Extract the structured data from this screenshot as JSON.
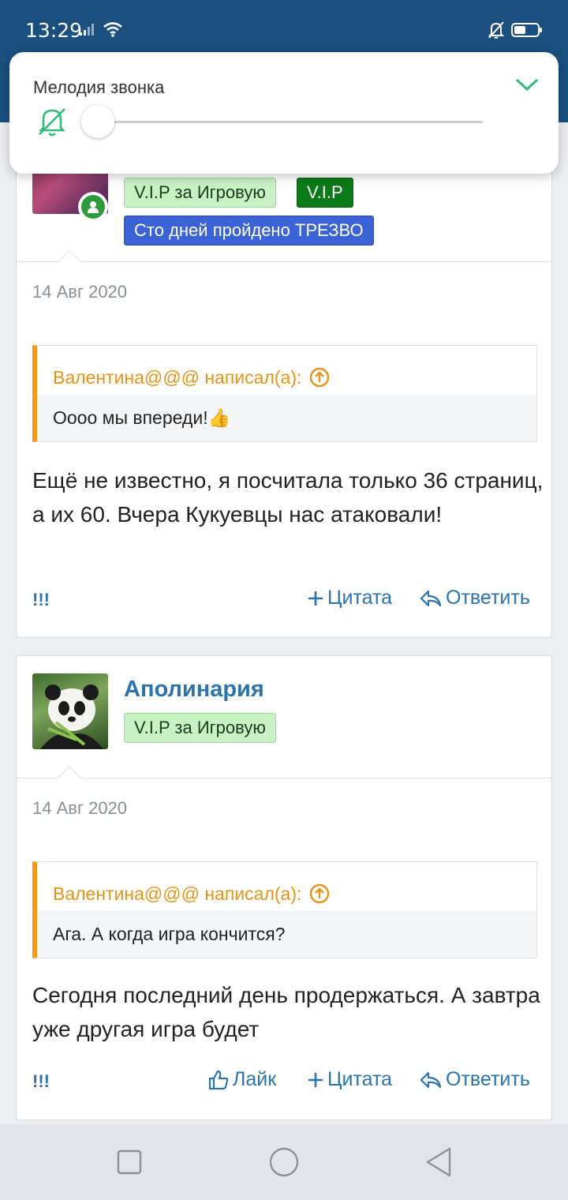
{
  "status_bar": {
    "time": "13:29",
    "icons": [
      "signal-icon",
      "wifi-icon",
      "bell-off-icon",
      "battery-icon"
    ]
  },
  "colors": {
    "header": "#1a4f7f",
    "link": "#2b73ae",
    "quote_accent": "#f29a17",
    "ring_accent": "#2ebd79",
    "badge_vip_game_bg": "#c8f2c4",
    "badge_vip_bg": "#0c7a18",
    "badge_sober_bg": "#3b63d6"
  },
  "ring_panel": {
    "title": "Мелодия звонка",
    "volume_fraction": 0.0,
    "icons": [
      "bell-off-icon",
      "chevron-down-icon"
    ]
  },
  "posts": [
    {
      "badges": [
        "V.I.P за Игровую",
        "V.I.P",
        "Сто дней пройдено ТРЕЗВО"
      ],
      "date": "14 Авг 2020",
      "quote_author": "Валентина@@@ написал(а):",
      "quote_text": "Оооо мы впереди!👍",
      "text": "Ещё не известно, я посчитала только 36 страниц, а их 60. Вчера Кукуевцы нас атаковали!",
      "report": "!!!",
      "quote_action": "Цитата",
      "reply_action": "Ответить"
    },
    {
      "username": "Аполинария",
      "badges": [
        "V.I.P за Игровую"
      ],
      "date": "14 Авг 2020",
      "quote_author": "Валентина@@@ написал(а):",
      "quote_text": "Ага. А когда игра кончится?",
      "text": "Сегодня последний день продержаться. А завтра уже другая игра будет",
      "report": "!!!",
      "like_action": "Лайк",
      "quote_action": "Цитата",
      "reply_action": "Ответить"
    }
  ],
  "nav_bar": {
    "icons": [
      "recents-square-icon",
      "home-circle-icon",
      "back-triangle-icon"
    ]
  }
}
